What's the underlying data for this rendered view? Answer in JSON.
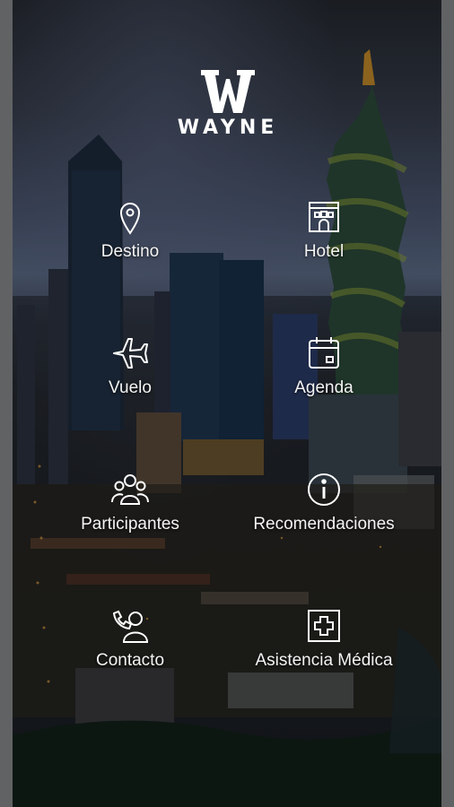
{
  "app": {
    "brand": "WAYNE",
    "brand_mark": "W"
  },
  "menu": {
    "items": [
      {
        "id": "destino",
        "label": "Destino",
        "icon": "map-pin-icon"
      },
      {
        "id": "hotel",
        "label": "Hotel",
        "icon": "hotel-building-icon"
      },
      {
        "id": "vuelo",
        "label": "Vuelo",
        "icon": "airplane-icon"
      },
      {
        "id": "agenda",
        "label": "Agenda",
        "icon": "calendar-icon"
      },
      {
        "id": "participantes",
        "label": "Participantes",
        "icon": "group-people-icon"
      },
      {
        "id": "recomendaciones",
        "label": "Recomendaciones",
        "icon": "info-circle-icon"
      },
      {
        "id": "contacto",
        "label": "Contacto",
        "icon": "phone-person-icon"
      },
      {
        "id": "asistencia",
        "label": "Asistencia Médica",
        "icon": "medical-cross-icon"
      }
    ]
  },
  "colors": {
    "icon_stroke": "#ffffff",
    "label_text": "#f4f4f4",
    "frame": "#616264"
  }
}
